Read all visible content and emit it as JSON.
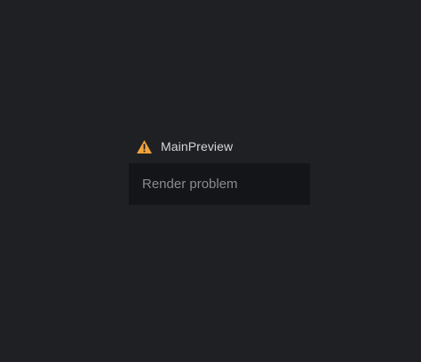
{
  "preview": {
    "title": "MainPreview",
    "icon": "warning-icon",
    "message": "Render problem"
  },
  "colors": {
    "background": "#1f2023",
    "panel": "#141519",
    "warning": "#f2a33a",
    "title_text": "#d6d7da",
    "message_text": "#8a8b90"
  }
}
